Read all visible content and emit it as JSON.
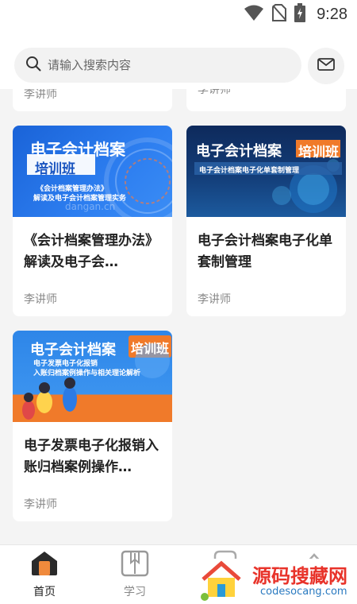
{
  "status_bar": {
    "time": "9:28",
    "icons": [
      "wifi-icon",
      "no-sim-icon",
      "battery-charging-icon"
    ]
  },
  "search": {
    "placeholder": "请输入搜索内容",
    "icon": "search-icon"
  },
  "mail": {
    "icon": "mail-icon"
  },
  "courses": [
    {
      "teacher": "李讲师"
    },
    {
      "teacher": "李讲师"
    },
    {
      "title": "《会计档案管理办法》解读及电子会…",
      "teacher": "李讲师",
      "thumb_title": "电子会计档案",
      "thumb_badge": "培训班",
      "thumb_sub1": "《会计档案管理办法》",
      "thumb_sub2": "解读及电子会计档案管理实务",
      "thumb_watermark": "dangan.cn"
    },
    {
      "title": "电子会计档案电子化单套制管理",
      "teacher": "李讲师",
      "thumb_title": "电子会计档案",
      "thumb_badge": "培训班",
      "thumb_sub1": "电子会计档案电子化单套制管理"
    },
    {
      "title": "电子发票电子化报销入账归档案例操作…",
      "teacher": "李讲师",
      "thumb_title": "电子会计档案",
      "thumb_badge": "培训班",
      "thumb_sub1": "电子发票电子化报销",
      "thumb_sub2": "入账归档案例操作与相关理论解析"
    }
  ],
  "nav": {
    "items": [
      {
        "label": "首页",
        "icon": "home-icon",
        "active": true
      },
      {
        "label": "学习",
        "icon": "book-icon",
        "active": false
      }
    ],
    "active_color": "#222222",
    "inactive_color": "#888888"
  },
  "watermark": {
    "title": "源码搜藏网",
    "url": "codesocang.com"
  },
  "colors": {
    "accent_orange": "#f07a2a",
    "nav_icon_fill": "#f08a3c"
  }
}
